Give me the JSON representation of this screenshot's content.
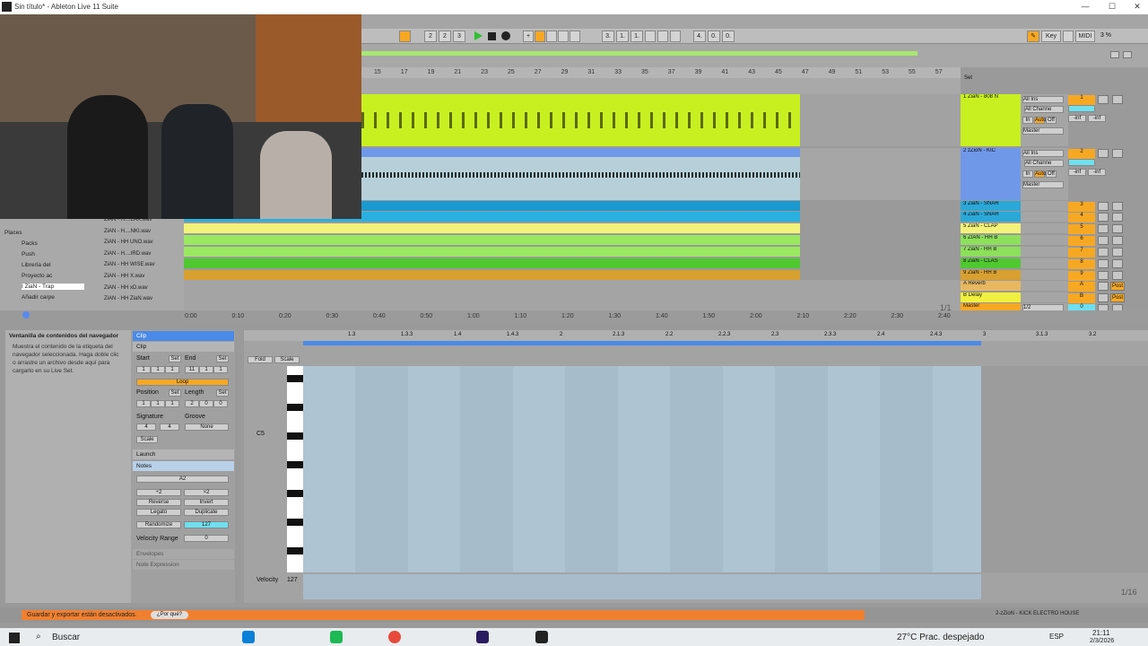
{
  "window": {
    "title": "Sin título* - Ableton Live 11 Suite"
  },
  "transport": {
    "tempo_fields": [
      "2",
      "2",
      "3"
    ],
    "position": [
      "3.",
      "1.",
      "1."
    ],
    "loop_len": [
      "4.",
      "0.",
      "0."
    ],
    "key": "Key",
    "midi": "MIDI",
    "cpu": "3 %"
  },
  "ruler": {
    "bars": [
      "15",
      "17",
      "19",
      "21",
      "23",
      "25",
      "27",
      "29",
      "31",
      "33",
      "35",
      "37",
      "39",
      "41",
      "43",
      "45",
      "47",
      "49",
      "51",
      "53",
      "55",
      "57"
    ]
  },
  "set_label": "Set",
  "tracks": [
    {
      "name": "1 ZiaN - 808 N",
      "color": "#c8f020",
      "num": "1",
      "input": "All Ins",
      "channel": "All Channe",
      "mon": [
        "In",
        "Auto",
        "Off"
      ],
      "vol": "-inf",
      "pan": "-inf",
      "out": "Master"
    },
    {
      "name": "2 zZioN - KIC",
      "color": "#6f98e8",
      "num": "2",
      "input": "All Ins",
      "channel": "All Channe",
      "mon": [
        "In",
        "Auto",
        "Off"
      ],
      "vol": "-inf",
      "pan": "-inf",
      "out": "Master"
    },
    {
      "name": "3 ZiaN - SNAR",
      "color": "#2aa8d8",
      "num": "3"
    },
    {
      "name": "4 ZiaN - SNAR",
      "color": "#2aa8d8",
      "num": "4"
    },
    {
      "name": "5 ZiaN - CLAP",
      "color": "#f2f27a",
      "num": "5"
    },
    {
      "name": "6 ZIAN - HH B",
      "color": "#8ce05a",
      "num": "6"
    },
    {
      "name": "7 ZiaN - HH B",
      "color": "#8ce05a",
      "num": "7"
    },
    {
      "name": "8 ZiaN - CLAS",
      "color": "#50c830",
      "num": "8"
    },
    {
      "name": "9 ZiaN - HH B",
      "color": "#d8a030",
      "num": "9"
    },
    {
      "name": "A Reverb",
      "color": "#e8b860",
      "num": "A",
      "post": "Post"
    },
    {
      "name": "B Delay",
      "color": "#f0f040",
      "num": "B",
      "post": "Post"
    },
    {
      "name": "Master",
      "color": "#f7a823",
      "num": "0",
      "out": "1/2"
    }
  ],
  "page_counter": "1/1",
  "browser": {
    "places_label": "Places",
    "places": [
      "Packs",
      "Push",
      "Librería del",
      "Proyecto ac",
      "I ZiaN - Trap",
      "Añadir carpe"
    ],
    "files": [
      "ZiAN - H....LAX.wav",
      "ZiAN - H....NKI.wav",
      "ZiAN - HH UNO.wav",
      "ZiAN - H....IRD.wav",
      "ZiAN - HH WISE.wav",
      "ZiAN - HH X.wav",
      "ZiAN - HH xD.wav",
      "ZiAN - HH ZiaN.wav"
    ]
  },
  "timebar": [
    "0:00",
    "0:10",
    "0:20",
    "0:30",
    "0:40",
    "0:50",
    "1:00",
    "1:10",
    "1:20",
    "1:30",
    "1:40",
    "1:50",
    "2:00",
    "2:10",
    "2:20",
    "2:30",
    "2:40"
  ],
  "info": {
    "title": "Ventanilla de contenidos del navegador",
    "body": "Muestra el contenido de la etiqueta del navegador seleccionada. Haga doble clic o arrastre un archivo desde aquí para cargarlo en su Live Set."
  },
  "clip": {
    "header": "Clip",
    "section": "Clip",
    "start": "Start",
    "end": "End",
    "set": "Set",
    "start_val": [
      "1",
      "1",
      "1"
    ],
    "end_val": [
      "11",
      "1",
      "1"
    ],
    "loop": "Loop",
    "position": "Position",
    "length": "Length",
    "pos_val": [
      "1",
      "1",
      "1"
    ],
    "len_val": [
      "2",
      "0",
      "0"
    ],
    "signature": "Signature",
    "groove": "Groove",
    "sig": [
      "4",
      "4"
    ],
    "groove_val": "None",
    "scale": "Scale",
    "launch": "Launch",
    "notes": "Notes",
    "note_name": "A2",
    "div": "÷2",
    "mul": "×2",
    "reverse": "Reverse",
    "invert": "Invert",
    "legato": "Legato",
    "duplicate": "Duplicate",
    "randomize": "Randomize",
    "rand_val": "127",
    "vel_range": "Velocity Range",
    "vel_val": "0",
    "envelopes": "Envelopes",
    "note_expr": "Note Expression"
  },
  "piano": {
    "ruler": [
      "1.3",
      "1.3.3",
      "1.4",
      "1.4.3",
      "2",
      "2.1.3",
      "2.2",
      "2.2.3",
      "2.3",
      "2.3.3",
      "2.4",
      "2.4.3",
      "3",
      "3.1.3",
      "3.2"
    ],
    "fold": "Fold",
    "scale": "Scale",
    "c5": "C5",
    "velocity": "Velocity",
    "vel127": "127",
    "pager": "1/16"
  },
  "status": {
    "msg": "Guardar y exportar están desactivados.",
    "why": "¿Por qué?",
    "track": "2-zZioN - KICK ELECTRO HOUSE"
  },
  "taskbar": {
    "search": "Buscar",
    "weather": "27°C  Prac. despejado",
    "lang": "ESP",
    "time": "21:11",
    "date": "2/3/2026"
  }
}
